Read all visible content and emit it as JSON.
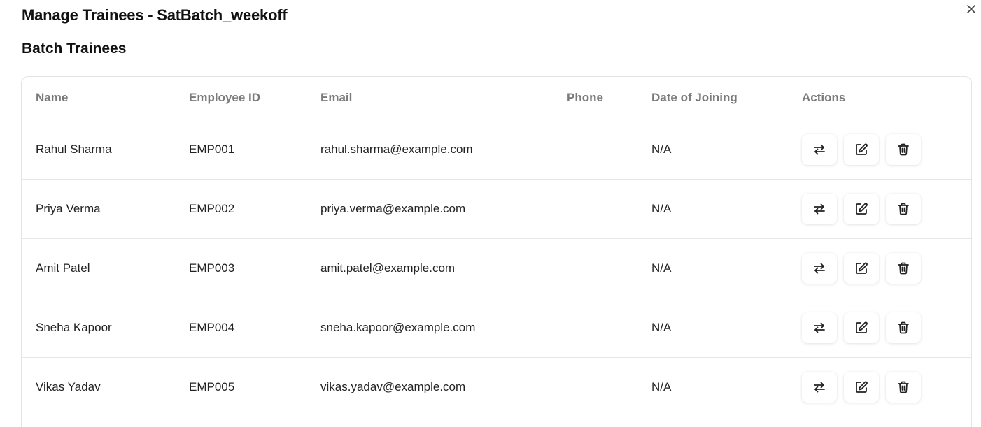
{
  "dialog": {
    "title": "Manage Trainees - SatBatch_weekoff",
    "close_icon": "close-icon"
  },
  "section": {
    "title": "Batch Trainees"
  },
  "table": {
    "headers": {
      "name": "Name",
      "employee_id": "Employee ID",
      "email": "Email",
      "phone": "Phone",
      "date_of_joining": "Date of Joining",
      "actions": "Actions"
    },
    "rows": [
      {
        "name": "Rahul Sharma",
        "employee_id": "EMP001",
        "email": "rahul.sharma@example.com",
        "phone": "",
        "date_of_joining": "N/A"
      },
      {
        "name": "Priya Verma",
        "employee_id": "EMP002",
        "email": "priya.verma@example.com",
        "phone": "",
        "date_of_joining": "N/A"
      },
      {
        "name": "Amit Patel",
        "employee_id": "EMP003",
        "email": "amit.patel@example.com",
        "phone": "",
        "date_of_joining": "N/A"
      },
      {
        "name": "Sneha Kapoor",
        "employee_id": "EMP004",
        "email": "sneha.kapoor@example.com",
        "phone": "",
        "date_of_joining": "N/A"
      },
      {
        "name": "Vikas Yadav",
        "employee_id": "EMP005",
        "email": "vikas.yadav@example.com",
        "phone": "",
        "date_of_joining": "N/A"
      }
    ],
    "row_action_icons": [
      "transfer-icon",
      "edit-icon",
      "delete-icon"
    ]
  }
}
